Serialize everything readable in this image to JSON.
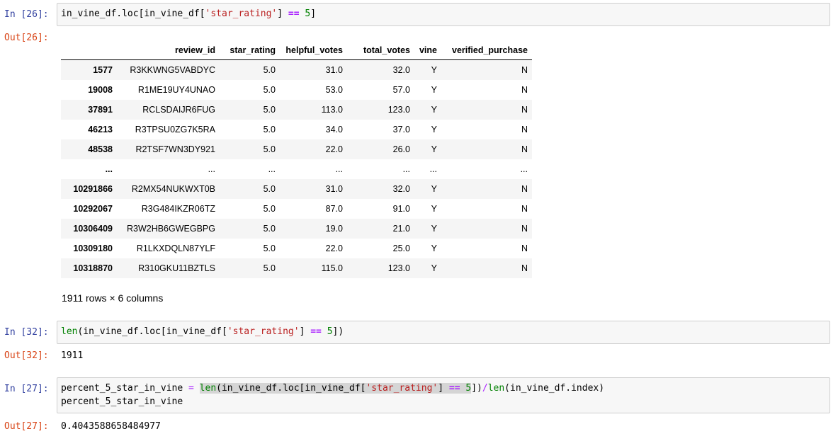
{
  "cells": [
    {
      "in_prompt": "In [26]:",
      "out_prompt": "Out[26]:",
      "code": {
        "var": "in_vine_df",
        "loc_open": ".loc[",
        "var2": "in_vine_df[",
        "key": "'star_rating'",
        "close_bracket": "]",
        "op": "==",
        "num": "5",
        "end": "]"
      }
    },
    {
      "in_prompt": "In [32]:",
      "out_prompt": "Out[32]:",
      "code": {
        "fn": "len",
        "pre": "(in_vine_df.loc[in_vine_df[",
        "key": "'star_rating'",
        "close_bracket": "]",
        "op": "==",
        "num": "5",
        "end": "])"
      },
      "output": "1911"
    },
    {
      "in_prompt": "In [27]:",
      "out_prompt": "Out[27]:",
      "code": {
        "lhs": "percent_5_star_in_vine",
        "assign": "=",
        "fn": "len",
        "pre": "(in_vine_df.loc[in_vine_df[",
        "key": "'star_rating'",
        "close_bracket": "]",
        "op": "==",
        "num": "5",
        "end": "])",
        "div": "/",
        "fn2": "len",
        "tail": "(in_vine_df.index)",
        "line2": "percent_5_star_in_vine"
      },
      "output": "0.4043588658484977"
    }
  ],
  "dataframe": {
    "columns": [
      "review_id",
      "star_rating",
      "helpful_votes",
      "total_votes",
      "vine",
      "verified_purchase"
    ],
    "rows": [
      {
        "index": "1577",
        "cells": [
          "R3KKWNG5VABDYC",
          "5.0",
          "31.0",
          "32.0",
          "Y",
          "N"
        ]
      },
      {
        "index": "19008",
        "cells": [
          "R1ME19UY4UNAO",
          "5.0",
          "53.0",
          "57.0",
          "Y",
          "N"
        ]
      },
      {
        "index": "37891",
        "cells": [
          "RCLSDAIJR6FUG",
          "5.0",
          "113.0",
          "123.0",
          "Y",
          "N"
        ]
      },
      {
        "index": "46213",
        "cells": [
          "R3TPSU0ZG7K5RA",
          "5.0",
          "34.0",
          "37.0",
          "Y",
          "N"
        ]
      },
      {
        "index": "48538",
        "cells": [
          "R2TSF7WN3DY921",
          "5.0",
          "22.0",
          "26.0",
          "Y",
          "N"
        ]
      },
      {
        "index": "...",
        "cells": [
          "...",
          "...",
          "...",
          "...",
          "...",
          "..."
        ]
      },
      {
        "index": "10291866",
        "cells": [
          "R2MX54NUKWXT0B",
          "5.0",
          "31.0",
          "32.0",
          "Y",
          "N"
        ]
      },
      {
        "index": "10292067",
        "cells": [
          "R3G484IKZR06TZ",
          "5.0",
          "87.0",
          "91.0",
          "Y",
          "N"
        ]
      },
      {
        "index": "10306409",
        "cells": [
          "R3W2HB6GWEGBPG",
          "5.0",
          "19.0",
          "21.0",
          "Y",
          "N"
        ]
      },
      {
        "index": "10309180",
        "cells": [
          "R1LKXDQLN87YLF",
          "5.0",
          "22.0",
          "25.0",
          "Y",
          "N"
        ]
      },
      {
        "index": "10318870",
        "cells": [
          "R310GKU11BZTLS",
          "5.0",
          "115.0",
          "123.0",
          "Y",
          "N"
        ]
      }
    ],
    "shape_note": "1911 rows × 6 columns"
  }
}
